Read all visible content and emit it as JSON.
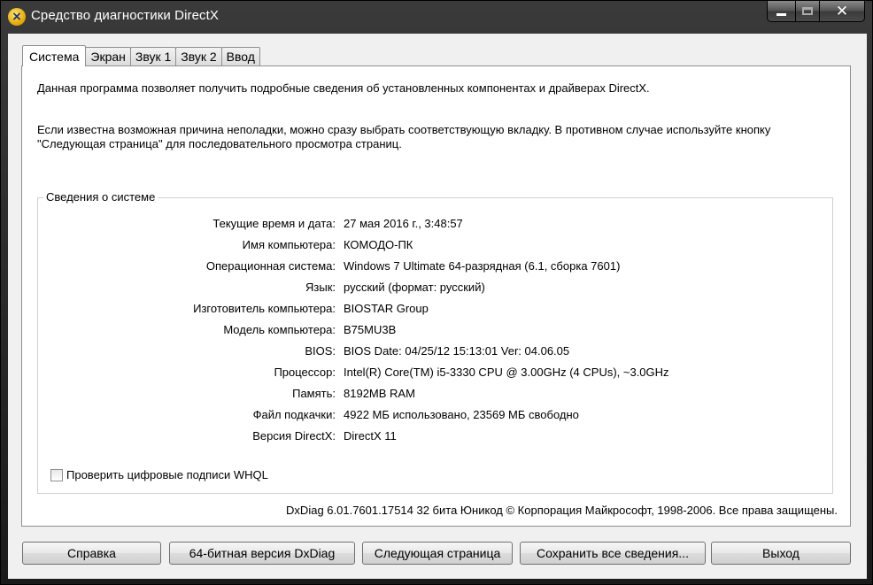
{
  "window": {
    "title": "Средство диагностики DirectX"
  },
  "tabs": [
    {
      "label": "Система",
      "active": true
    },
    {
      "label": "Экран",
      "active": false
    },
    {
      "label": "Звук 1",
      "active": false
    },
    {
      "label": "Звук 2",
      "active": false
    },
    {
      "label": "Ввод",
      "active": false
    }
  ],
  "intro": {
    "line1": "Данная программа позволяет получить подробные сведения об установленных компонентах и драйверах DirectX.",
    "line2": "Если известна возможная причина неполадки, можно сразу выбрать соответствующую вкладку. В противном случае используйте кнопку \"Следующая страница\" для последовательного просмотра страниц."
  },
  "system_info": {
    "title": "Сведения о системе",
    "rows": [
      {
        "label": "Текущие время и дата:",
        "value": "27 мая 2016 г., 3:48:57"
      },
      {
        "label": "Имя компьютера:",
        "value": "КОМОДО-ПК"
      },
      {
        "label": "Операционная система:",
        "value": "Windows 7 Ultimate 64-разрядная (6.1, сборка 7601)"
      },
      {
        "label": "Язык:",
        "value": "русский (формат: русский)"
      },
      {
        "label": "Изготовитель компьютера:",
        "value": "BIOSTAR Group"
      },
      {
        "label": "Модель компьютера:",
        "value": "B75MU3B"
      },
      {
        "label": "BIOS:",
        "value": "BIOS Date: 04/25/12 15:13:01 Ver: 04.06.05"
      },
      {
        "label": "Процессор:",
        "value": "Intel(R) Core(TM) i5-3330 CPU @ 3.00GHz (4 CPUs), ~3.0GHz"
      },
      {
        "label": "Память:",
        "value": "8192MB RAM"
      },
      {
        "label": "Файл подкачки:",
        "value": "4922 МБ использовано, 23569 МБ свободно"
      },
      {
        "label": "Версия DirectX:",
        "value": "DirectX 11"
      }
    ]
  },
  "whql_checkbox": {
    "label": "Проверить цифровые подписи WHQL",
    "checked": false
  },
  "footer": "DxDiag 6.01.7601.17514 32 бита Юникод  © Корпорация Майкрософт, 1998-2006.  Все права защищены.",
  "buttons": {
    "help": "Справка",
    "dxdiag64": "64-битная версия DxDiag",
    "next_page": "Следующая страница",
    "save_all": "Сохранить все сведения...",
    "exit": "Выход"
  }
}
